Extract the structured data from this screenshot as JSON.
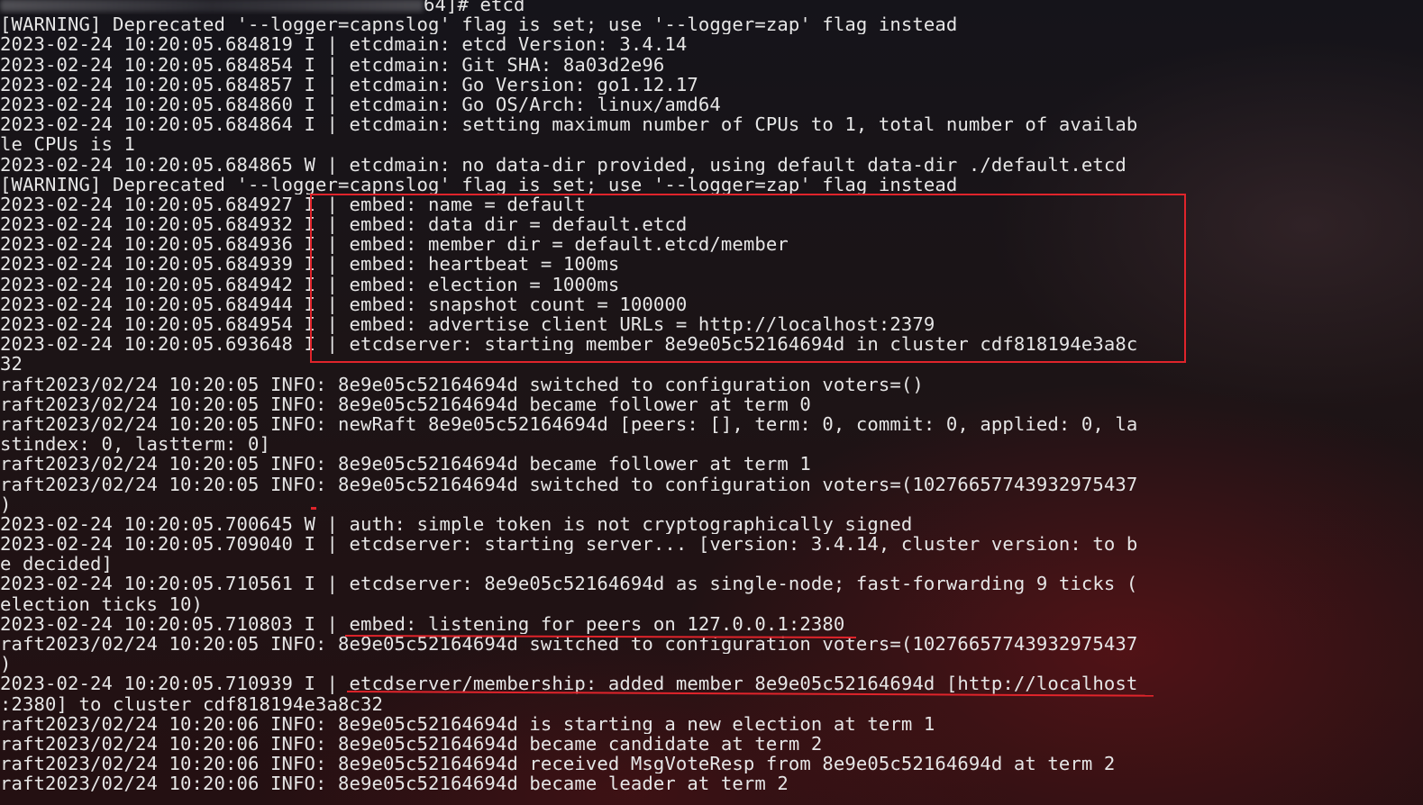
{
  "prompt": {
    "suffix": "64]# etcd"
  },
  "lines": [
    "[WARNING] Deprecated '--logger=capnslog' flag is set; use '--logger=zap' flag instead",
    "2023-02-24 10:20:05.684819 I | etcdmain: etcd Version: 3.4.14",
    "2023-02-24 10:20:05.684854 I | etcdmain: Git SHA: 8a03d2e96",
    "2023-02-24 10:20:05.684857 I | etcdmain: Go Version: go1.12.17",
    "2023-02-24 10:20:05.684860 I | etcdmain: Go OS/Arch: linux/amd64",
    "2023-02-24 10:20:05.684864 I | etcdmain: setting maximum number of CPUs to 1, total number of availab",
    "le CPUs is 1",
    "2023-02-24 10:20:05.684865 W | etcdmain: no data-dir provided, using default data-dir ./default.etcd",
    "[WARNING] Deprecated '--logger=capnslog' flag is set; use '--logger=zap' flag instead",
    "2023-02-24 10:20:05.684927 I | embed: name = default",
    "2023-02-24 10:20:05.684932 I | embed: data dir = default.etcd",
    "2023-02-24 10:20:05.684936 I | embed: member dir = default.etcd/member",
    "2023-02-24 10:20:05.684939 I | embed: heartbeat = 100ms",
    "2023-02-24 10:20:05.684942 I | embed: election = 1000ms",
    "2023-02-24 10:20:05.684944 I | embed: snapshot count = 100000",
    "2023-02-24 10:20:05.684954 I | embed: advertise client URLs = http://localhost:2379",
    "2023-02-24 10:20:05.693648 I | etcdserver: starting member 8e9e05c52164694d in cluster cdf818194e3a8c",
    "32",
    "raft2023/02/24 10:20:05 INFO: 8e9e05c52164694d switched to configuration voters=()",
    "raft2023/02/24 10:20:05 INFO: 8e9e05c52164694d became follower at term 0",
    "raft2023/02/24 10:20:05 INFO: newRaft 8e9e05c52164694d [peers: [], term: 0, commit: 0, applied: 0, la",
    "stindex: 0, lastterm: 0]",
    "raft2023/02/24 10:20:05 INFO: 8e9e05c52164694d became follower at term 1",
    "raft2023/02/24 10:20:05 INFO: 8e9e05c52164694d switched to configuration voters=(10276657743932975437",
    ")",
    "2023-02-24 10:20:05.700645 W | auth: simple token is not cryptographically signed",
    "2023-02-24 10:20:05.709040 I | etcdserver: starting server... [version: 3.4.14, cluster version: to_b",
    "e_decided]",
    "2023-02-24 10:20:05.710561 I | etcdserver: 8e9e05c52164694d as single-node; fast-forwarding 9 ticks (",
    "election ticks 10)",
    "2023-02-24 10:20:05.710803 I | embed: listening for peers on 127.0.0.1:2380",
    "raft2023/02/24 10:20:05 INFO: 8e9e05c52164694d switched to configuration voters=(10276657743932975437",
    ")",
    "2023-02-24 10:20:05.710939 I | etcdserver/membership: added member 8e9e05c52164694d [http://localhost",
    ":2380] to cluster cdf818194e3a8c32",
    "raft2023/02/24 10:20:06 INFO: 8e9e05c52164694d is starting a new election at term 1",
    "raft2023/02/24 10:20:06 INFO: 8e9e05c52164694d became candidate at term 2",
    "raft2023/02/24 10:20:06 INFO: 8e9e05c52164694d received MsgVoteResp from 8e9e05c52164694d at term 2",
    "raft2023/02/24 10:20:06 INFO: 8e9e05c52164694d became leader at term 2"
  ],
  "colors": {
    "text": "#e6e6e6",
    "annotation": "#e0242b",
    "background": "#0d0d10"
  }
}
